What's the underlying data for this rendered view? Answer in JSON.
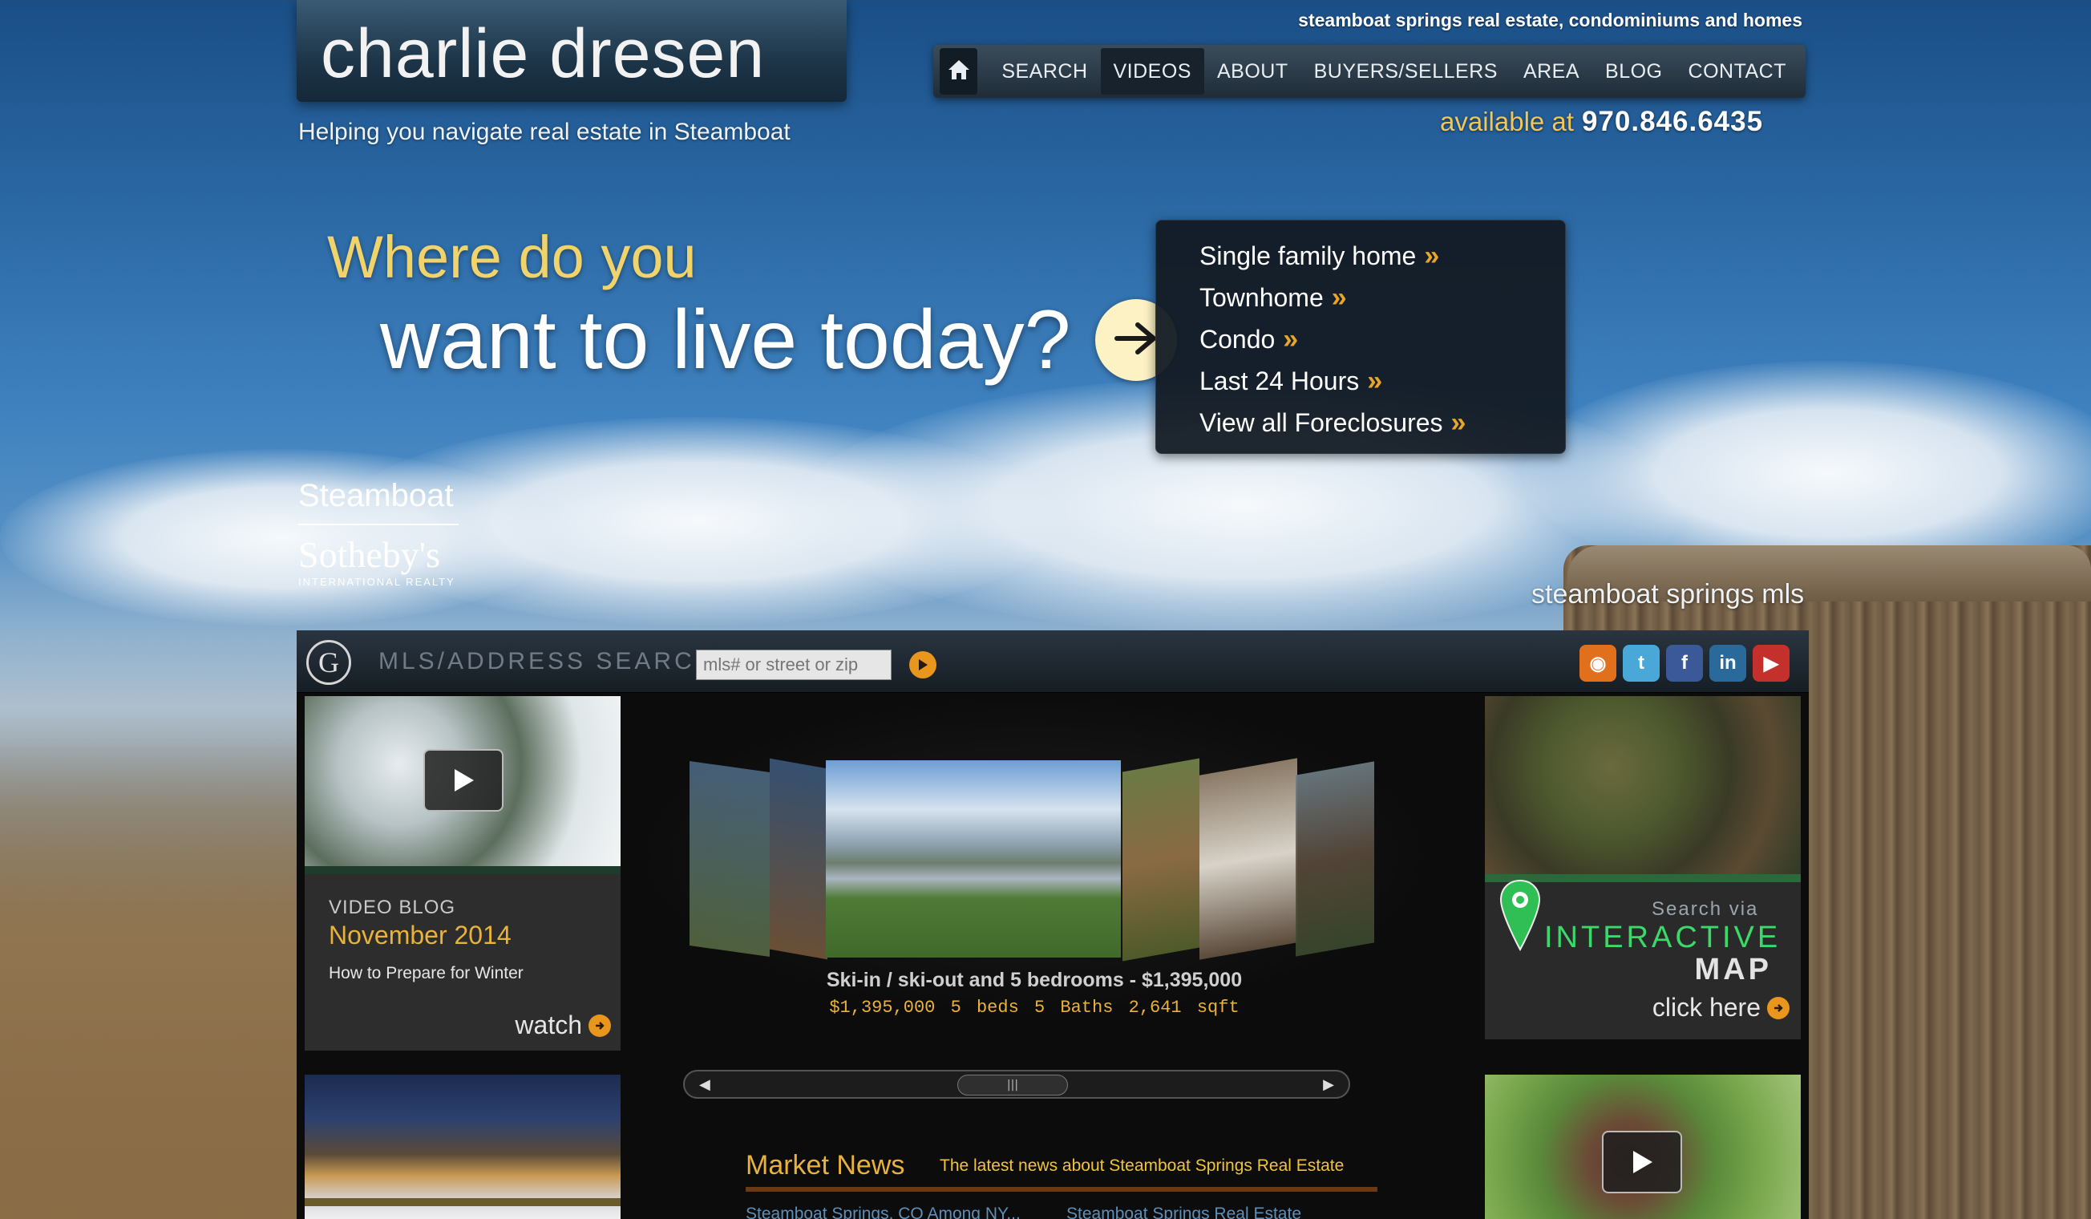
{
  "header": {
    "logo": "charlie dresen",
    "tagline": "Helping you navigate real estate in Steamboat",
    "top_tag": "steamboat springs real estate, condominiums and homes",
    "available_label": "available at",
    "phone": "970.846.6435"
  },
  "nav": {
    "home_icon": "home-icon",
    "items": [
      {
        "label": "SEARCH"
      },
      {
        "label": "VIDEOS"
      },
      {
        "label": "ABOUT"
      },
      {
        "label": "BUYERS/SELLERS"
      },
      {
        "label": "AREA"
      },
      {
        "label": "BLOG"
      },
      {
        "label": "CONTACT"
      }
    ],
    "active_index": 1
  },
  "hero": {
    "line1": "Where do you",
    "line2": "want to live today?",
    "menu": [
      {
        "label": "Single family home"
      },
      {
        "label": "Townhome"
      },
      {
        "label": "Condo"
      },
      {
        "label": "Last 24 Hours"
      },
      {
        "label": "View all Foreclosures"
      }
    ],
    "chevron": "»"
  },
  "brand": {
    "line1": "Steamboat",
    "line2": "Sotheby's",
    "line3": "INTERNATIONAL REALTY"
  },
  "mls_label": "steamboat springs mls",
  "search": {
    "logo_letter": "G",
    "label": "MLS/ADDRESS SEARCH",
    "placeholder": "mls# or street or zip"
  },
  "social": [
    {
      "name": "rss-icon",
      "color": "#e0701c",
      "glyph": "◉"
    },
    {
      "name": "twitter-icon",
      "color": "#4aa8d8",
      "glyph": "t"
    },
    {
      "name": "facebook-icon",
      "color": "#3b5998",
      "glyph": "f"
    },
    {
      "name": "linkedin-icon",
      "color": "#2a6a9a",
      "glyph": "in"
    },
    {
      "name": "youtube-icon",
      "color": "#c4302b",
      "glyph": "▶"
    }
  ],
  "video_blog": {
    "label": "VIDEO BLOG",
    "date": "November 2014",
    "title": "How to Prepare for Winter",
    "cta": "watch"
  },
  "listing": {
    "title": "Ski-in / ski-out and 5 bedrooms - $1,395,000",
    "price": "$1,395,000",
    "beds": "5 beds",
    "baths": "5 Baths",
    "sqft": "2,641 sqft"
  },
  "news": {
    "title": "Market News",
    "subtitle": "The latest news about Steamboat Springs Real Estate",
    "links": [
      {
        "label": "Steamboat Springs, CO Among NY..."
      },
      {
        "label": "Steamboat Springs Real Estate"
      }
    ]
  },
  "map": {
    "line1": "Search via",
    "line2": "INTERACTIVE",
    "line3": "MAP",
    "cta": "click here"
  },
  "colors": {
    "accent_gold": "#e9b23a",
    "accent_orange": "#e8961c",
    "map_green": "#3bd96a"
  }
}
